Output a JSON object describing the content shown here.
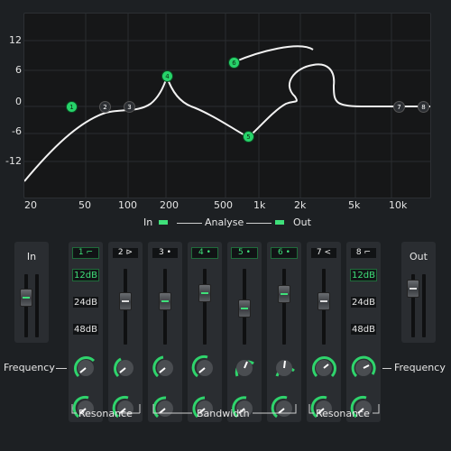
{
  "graph": {
    "y_labels": [
      "12",
      "6",
      "0",
      "-6",
      "-12"
    ],
    "x_labels": [
      "20",
      "50",
      "100",
      "200",
      "500",
      "1k",
      "2k",
      "5k",
      "10k"
    ],
    "nodes": [
      {
        "num": "1",
        "active": true
      },
      {
        "num": "2",
        "active": false
      },
      {
        "num": "3",
        "active": false
      },
      {
        "num": "4",
        "active": true
      },
      {
        "num": "5",
        "active": true
      },
      {
        "num": "6",
        "active": true
      },
      {
        "num": "7",
        "active": false
      },
      {
        "num": "8",
        "active": false
      }
    ]
  },
  "analyse": {
    "in_label": "In",
    "center_label": "Analyse",
    "out_label": "Out",
    "indicator_color": "#3fe07a"
  },
  "io": {
    "in_title": "In",
    "out_title": "Out"
  },
  "bands": [
    {
      "label": "1 ⌐",
      "green": true
    },
    {
      "label": "2 ⊳",
      "green": false
    },
    {
      "label": "3 •",
      "green": false
    },
    {
      "label": "4 •",
      "green": true
    },
    {
      "label": "5 •",
      "green": true
    },
    {
      "label": "6 •",
      "green": true
    },
    {
      "label": "7 <",
      "green": false
    },
    {
      "label": "8 ⌐",
      "green": false
    }
  ],
  "slopes": {
    "s12": "12dB",
    "s24": "24dB",
    "s48": "48dB"
  },
  "labels": {
    "frequency_left": "Frequency",
    "frequency_right": "Frequency",
    "resonance_left": "Resonance",
    "bandwidth": "Bandwidth",
    "resonance_right": "Resonance"
  },
  "accent_color": "#3fe07a"
}
